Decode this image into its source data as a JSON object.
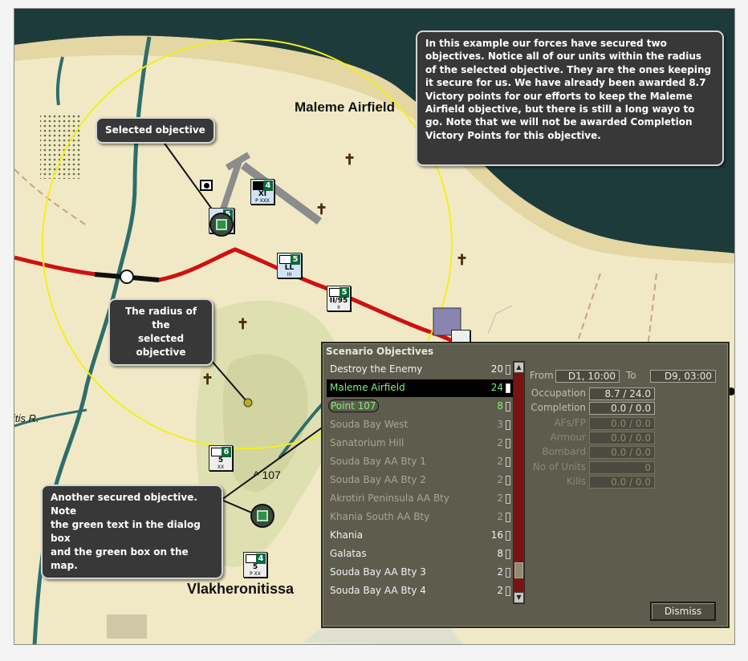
{
  "map": {
    "place_labels": {
      "maleme": "Maleme Airfield",
      "vlakh": "Vlakheronitissa",
      "river": "itis R.",
      "height": "^ 107"
    },
    "units": [
      {
        "name": "XI",
        "strength": "4",
        "size": "P XXX"
      },
      {
        "name": "",
        "strength": "5",
        "size": ""
      },
      {
        "name": "LL",
        "strength": "5",
        "size": "III"
      },
      {
        "name": "II/95",
        "strength": "5",
        "size": "II"
      },
      {
        "name": "5",
        "strength": "6",
        "size": "XX"
      },
      {
        "name": "5",
        "strength": "4",
        "size": "P XX"
      }
    ],
    "colors": {
      "sea": "#1d3a3a",
      "land": "#f1e9c6",
      "road": "#d01010",
      "radius": "#f2ef1c",
      "river": "#2e6e6c"
    }
  },
  "callouts": {
    "info": "In this example our forces have secured two objectives. Notice all of our units within the radius of the selected objective. They are the ones keeping it secure for us. We have already been awarded 8.7 Victory points for our efforts to keep the Maleme Airfield objective, but there is still a long wayo to go. Note that we will not be awarded Completion Victory Points for this objective.",
    "selected": "Selected objective",
    "radius_line1": "The radius of the",
    "radius_line2": "selected objective",
    "another_line1": "Another  secured objective. Note",
    "another_line2": "the green text in the dialog box",
    "another_line3": "and the green box on the map."
  },
  "dialog": {
    "title": "Scenario Objectives",
    "objectives": [
      {
        "name": "Destroy the Enemy",
        "points": "20",
        "style": "white"
      },
      {
        "name": "Maleme Airfield",
        "points": "24",
        "style": "sel"
      },
      {
        "name": "Point 107",
        "points": "8",
        "style": "green"
      },
      {
        "name": "Souda Bay West",
        "points": "3",
        "style": "dim"
      },
      {
        "name": "Sanatorium Hill",
        "points": "2",
        "style": "dim"
      },
      {
        "name": "Souda Bay AA Bty 1",
        "points": "2",
        "style": "dim"
      },
      {
        "name": "Souda Bay AA Bty 2",
        "points": "2",
        "style": "dim"
      },
      {
        "name": "Akrotiri Peninsula AA Bty",
        "points": "2",
        "style": "dim"
      },
      {
        "name": "Khania South AA Bty",
        "points": "2",
        "style": "dim"
      },
      {
        "name": "Khania",
        "points": "16",
        "style": "white"
      },
      {
        "name": "Galatas",
        "points": "8",
        "style": "white"
      },
      {
        "name": "Souda Bay AA Bty 3",
        "points": "2",
        "style": "white"
      },
      {
        "name": "Souda Bay AA Bty 4",
        "points": "2",
        "style": "white"
      }
    ],
    "from_label": "From",
    "from_value": "D1, 10:00",
    "to_label": "To",
    "to_value": "D9, 03:00",
    "stats": [
      {
        "label": "Occupation",
        "value": "8.7 / 24.0",
        "dim": false
      },
      {
        "label": "Completion",
        "value": "0.0 / 0.0",
        "dim": false
      },
      {
        "label": "AFs/FP",
        "value": "0.0 / 0.0",
        "dim": true
      },
      {
        "label": "Armour",
        "value": "0.0 / 0.0",
        "dim": true
      },
      {
        "label": "Bombard",
        "value": "0.0 / 0.0",
        "dim": true
      },
      {
        "label": "No of Units",
        "value": "0",
        "dim": true
      },
      {
        "label": "Kills",
        "value": "0.0 / 0.0",
        "dim": true
      }
    ],
    "dismiss_label": "Dismiss"
  }
}
